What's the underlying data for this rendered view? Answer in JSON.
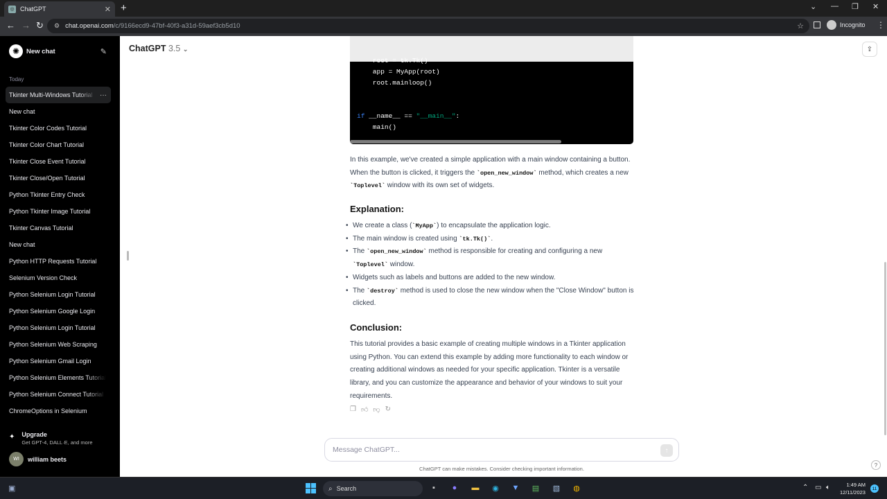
{
  "browser": {
    "tab_title": "ChatGPT",
    "url_host": "chat.openai.com",
    "url_path": "/c/9166ecd9-47bf-40f3-a31d-59aef3cb5d10",
    "incognito_label": "Incognito"
  },
  "sidebar": {
    "new_chat": "New chat",
    "section": "Today",
    "items": [
      {
        "label": "Tkinter Multi-Windows Tutorial",
        "active": true
      },
      {
        "label": "New chat"
      },
      {
        "label": "Tkinter Color Codes Tutorial"
      },
      {
        "label": "Tkinter Color Chart Tutorial"
      },
      {
        "label": "Tkinter Close Event Tutorial"
      },
      {
        "label": "Tkinter Close/Open Tutorial"
      },
      {
        "label": "Python Tkinter Entry Check"
      },
      {
        "label": "Python Tkinter Image Tutorial"
      },
      {
        "label": "Tkinter Canvas Tutorial"
      },
      {
        "label": "New chat"
      },
      {
        "label": "Python HTTP Requests Tutorial"
      },
      {
        "label": "Selenium Version Check"
      },
      {
        "label": "Python Selenium Login Tutorial"
      },
      {
        "label": "Python Selenium Google Login"
      },
      {
        "label": "Python Selenium Login Tutorial"
      },
      {
        "label": "Python Selenium Web Scraping"
      },
      {
        "label": "Python Selenium Gmail Login"
      },
      {
        "label": "Python Selenium Elements Tutorial"
      },
      {
        "label": "Python Selenium Connect Tutorial"
      },
      {
        "label": "ChromeOptions in Selenium"
      }
    ],
    "upgrade_title": "Upgrade",
    "upgrade_sub": "Get GPT-4, DALL·E, and more",
    "avatar_initials": "WI",
    "user_name": "william beets"
  },
  "header": {
    "model": "ChatGPT",
    "version": "3.5"
  },
  "code": {
    "lines": [
      "    root = tk.Tk()",
      "    app = MyApp(root)",
      "    root.mainloop()",
      "",
      "",
      "if __name__ == \"__main__\":",
      "    main()"
    ]
  },
  "content": {
    "p1_a": "In this example, we've created a simple application with a main window containing a button. When the button is clicked, it triggers the ",
    "p1_code1": "`open_new_window`",
    "p1_b": " method, which creates a new ",
    "p1_code2": "`Toplevel`",
    "p1_c": " window with its own set of widgets.",
    "explanation_heading": "Explanation:",
    "b1_a": "We create a class (",
    "b1_code": "`MyApp`",
    "b1_b": ") to encapsulate the application logic.",
    "b2_a": "The main window is created using ",
    "b2_code": "`tk.Tk()`",
    "b2_b": ".",
    "b3_a": "The ",
    "b3_code1": "`open_new_window`",
    "b3_b": " method is responsible for creating and configuring a new ",
    "b3_code2": "`Toplevel`",
    "b3_c": " window.",
    "b4": "Widgets such as labels and buttons are added to the new window.",
    "b5_a": "The ",
    "b5_code": "`destroy`",
    "b5_b": " method is used to close the new window when the \"Close Window\" button is clicked.",
    "conclusion_heading": "Conclusion:",
    "p2": "This tutorial provides a basic example of creating multiple windows in a Tkinter application using Python. You can extend this example by adding more functionality to each window or creating additional windows as needed for your specific application. Tkinter is a versatile library, and you can customize the appearance and behavior of your windows to suit your requirements."
  },
  "composer": {
    "placeholder": "Message ChatGPT...",
    "disclaimer": "ChatGPT can make mistakes. Consider checking important information."
  },
  "taskbar": {
    "search": "Search",
    "time": "1:49 AM",
    "date": "12/11/2023",
    "notifications": "11"
  }
}
